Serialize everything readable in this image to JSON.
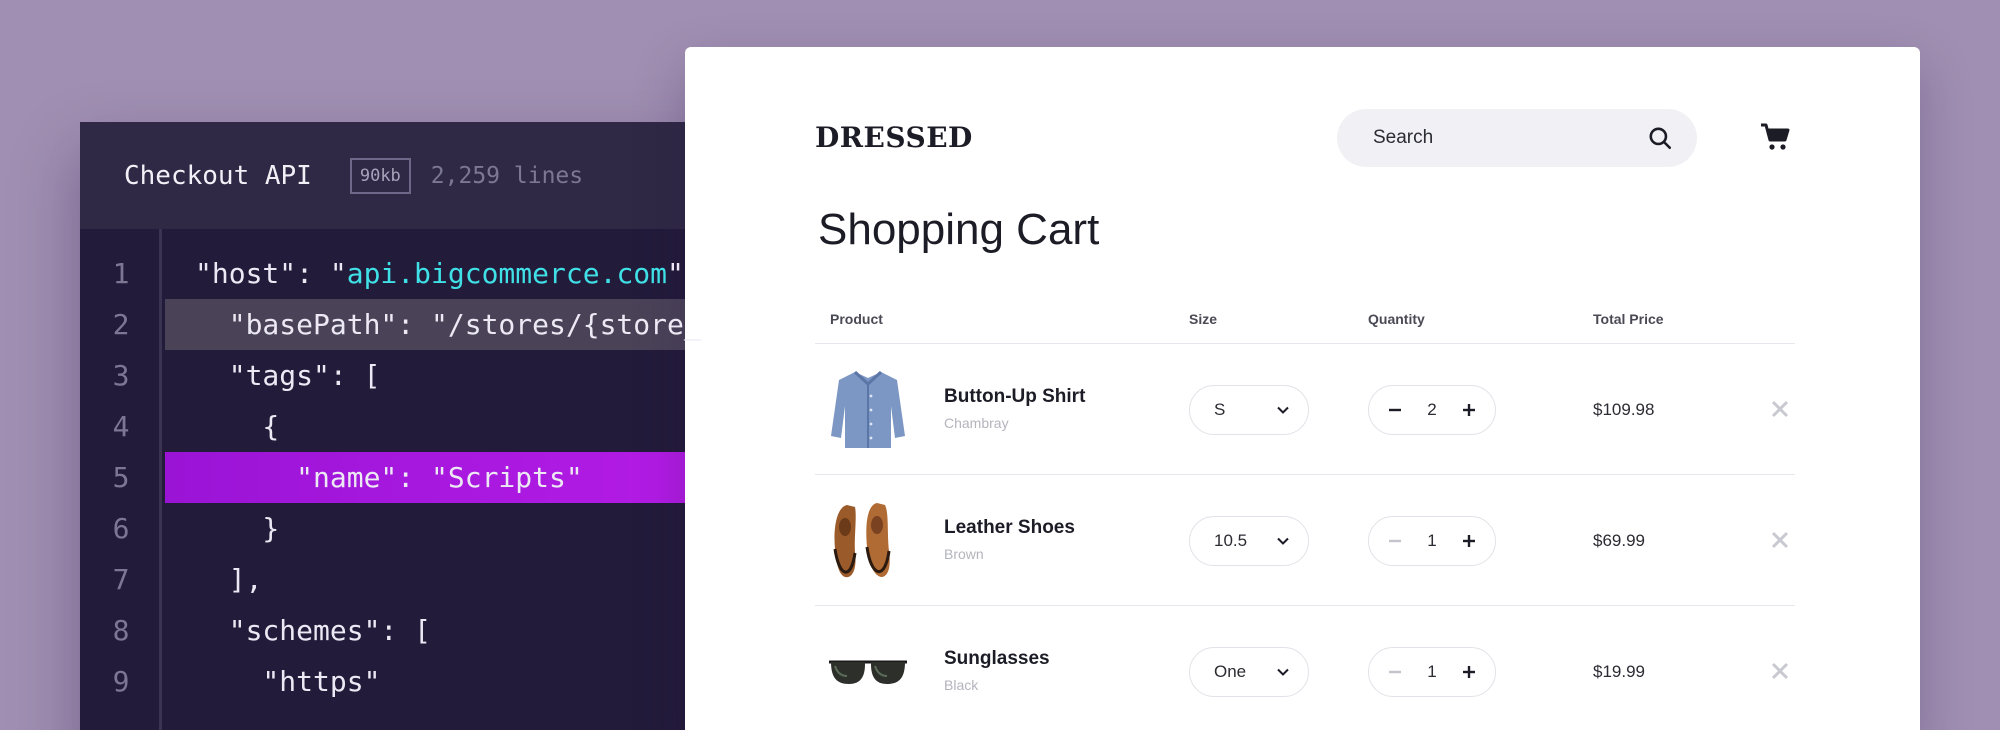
{
  "editor": {
    "title": "Checkout API",
    "size_badge": "90kb",
    "lines_count": "2,259 lines",
    "lines": [
      {
        "num": "1",
        "pre": "\"host\": \"",
        "link": "api.bigcommerce.com",
        "post": "\""
      },
      {
        "num": "2",
        "pre": "  \"basePath\": \"/stores/{store_",
        "link": "",
        "post": ""
      },
      {
        "num": "3",
        "pre": "  \"tags\": [",
        "link": "",
        "post": ""
      },
      {
        "num": "4",
        "pre": "    {",
        "link": "",
        "post": ""
      },
      {
        "num": "5",
        "pre": "      \"name\": \"Scripts\"",
        "link": "",
        "post": ""
      },
      {
        "num": "6",
        "pre": "    }",
        "link": "",
        "post": ""
      },
      {
        "num": "7",
        "pre": "  ],",
        "link": "",
        "post": ""
      },
      {
        "num": "8",
        "pre": "  \"schemes\": [",
        "link": "",
        "post": ""
      },
      {
        "num": "9",
        "pre": "    \"https\"",
        "link": "",
        "post": ""
      }
    ]
  },
  "shop": {
    "logo": "DRESSED",
    "search_placeholder": "Search",
    "page_title": "Shopping Cart",
    "columns": {
      "product": "Product",
      "size": "Size",
      "quantity": "Quantity",
      "total": "Total Price"
    },
    "items": [
      {
        "name": "Button-Up Shirt",
        "variant": "Chambray",
        "size": "S",
        "quantity": "2",
        "price": "$109.98"
      },
      {
        "name": "Leather Shoes",
        "variant": "Brown",
        "size": "10.5",
        "quantity": "1",
        "price": "$69.99"
      },
      {
        "name": "Sunglasses",
        "variant": "Black",
        "size": "One",
        "quantity": "1",
        "price": "$19.99"
      }
    ]
  },
  "colors": {
    "background": "#a08fb2",
    "editor_bg": "#231b3a",
    "highlight_purple": "#a818de",
    "link_cyan": "#3fe0e6"
  },
  "icons": [
    "search-icon",
    "cart-icon",
    "chevron-down-icon",
    "minus-icon",
    "plus-icon",
    "close-icon"
  ]
}
